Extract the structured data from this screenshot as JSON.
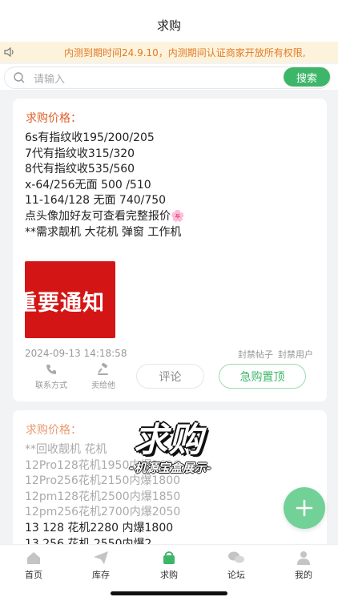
{
  "header": {
    "title": "求购"
  },
  "notice": {
    "icon": "speaker-icon",
    "text": "内测到期时间24.9.10，内测期间认证商家开放所有权限,"
  },
  "search": {
    "placeholder": "请输入",
    "button_label": "搜索",
    "accent_color": "#3db669"
  },
  "posts": [
    {
      "price_label": "求购价格：",
      "lines": [
        "6s有指纹收195/200/205",
        "7代有指纹收315/320",
        "8代有指纹收535/560",
        "x-64/256无面 500 /510",
        "11-164/128 无面 740/750",
        "点头像加好友可查看完整报价🌸",
        "**需求靓机 大花机 弹窗 工作机"
      ],
      "image_text": "重要通知",
      "date": "2024-09-13 14:18:58",
      "ban_post": "封禁帖子",
      "ban_user": "封禁用户",
      "actions": {
        "contact": "联系方式",
        "sell": "卖给他",
        "comment": "评论",
        "urgent": "急购置顶"
      }
    },
    {
      "price_label": "求购价格：",
      "lines": [
        "**回收靓机 花机",
        "12Pro128花机1950内爆1600",
        "12Pro256花机2150内爆1800",
        "12pm128花机2500内爆1850",
        "12pm256花机2700内爆2050",
        "13  128   花机2280 内爆1800",
        "13  256   花机 2550内爆2"
      ]
    }
  ],
  "watermark": {
    "title": "求购",
    "subtitle": "-机源宝盒展示-"
  },
  "fab": {
    "icon": "plus-icon"
  },
  "tabbar": {
    "active_color": "#3db669",
    "items": [
      {
        "label": "首页",
        "icon": "home-icon"
      },
      {
        "label": "库存",
        "icon": "send-icon"
      },
      {
        "label": "求购",
        "icon": "shopping-bag-icon"
      },
      {
        "label": "论坛",
        "icon": "chat-bubbles-icon"
      },
      {
        "label": "我的",
        "icon": "user-icon"
      }
    ]
  }
}
